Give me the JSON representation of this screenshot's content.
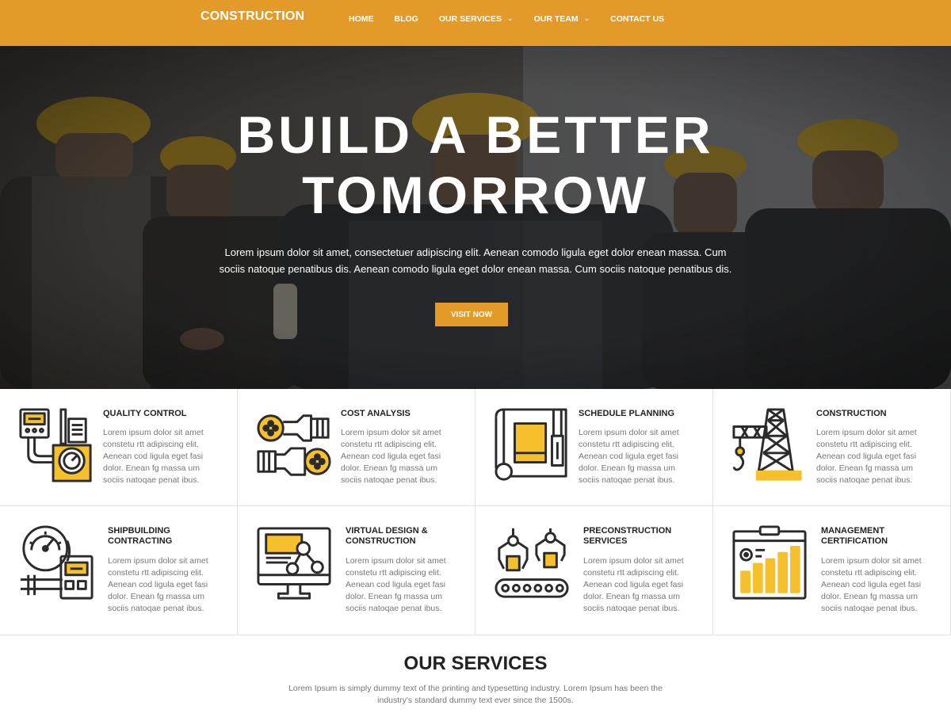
{
  "header": {
    "brand": "CONSTRUCTION",
    "nav": [
      {
        "label": "HOME",
        "dropdown": false
      },
      {
        "label": "BLOG",
        "dropdown": false
      },
      {
        "label": "OUR SERVICES",
        "dropdown": true
      },
      {
        "label": "OUR TEAM",
        "dropdown": true
      },
      {
        "label": "CONTACT US",
        "dropdown": false
      }
    ]
  },
  "hero": {
    "title_line1": "BUILD A BETTER",
    "title_line2": "TOMORROW",
    "text": "Lorem ipsum dolor sit amet, consectetuer adipiscing elit. Aenean comodo ligula eget dolor enean massa. Cum sociis natoque penatibus dis. Aenean comodo ligula eget dolor enean massa. Cum sociis natoque penatibus dis.",
    "button": "VISIT NOW"
  },
  "features": [
    {
      "title": "QUALITY CONTROL",
      "icon": "quality-control-icon",
      "text": "Lorem ipsum dolor sit amet constetu rtt adipiscing elit. Aenean cod ligula eget fasi dolor. Enean fg massa um sociis natoqae penat ibus."
    },
    {
      "title": "COST ANALYSIS",
      "icon": "cost-analysis-icon",
      "text": "Lorem ipsum dolor sit amet constetu rtt adipiscing elit. Aenean cod ligula eget fasi dolor. Enean fg massa um sociis natoqae penat ibus."
    },
    {
      "title": "SCHEDULE PLANNING",
      "icon": "blueprint-icon",
      "text": "Lorem ipsum dolor sit amet constetu rtt adipiscing elit. Aenean cod ligula eget fasi dolor. Enean fg massa um sociis natoqae penat ibus."
    },
    {
      "title": "CONSTRUCTION",
      "icon": "crane-icon",
      "text": "Lorem ipsum dolor sit amet constetu rtt adipiscing elit. Aenean cod ligula eget fasi dolor. Enean fg massa um sociis natoqae penat ibus."
    },
    {
      "title": "SHIPBUILDING CONTRACTING",
      "icon": "gauge-meter-icon",
      "text": "Lorem ipsum dolor sit amet constetu rtt adipiscing elit. Aenean cod ligula eget fasi dolor. Enean fg massa um sociis natoqae penat ibus."
    },
    {
      "title": "VIRTUAL DESIGN & CONSTRUCTION",
      "icon": "monitor-design-icon",
      "text": "Lorem ipsum dolor sit amet constetu rtt adipiscing elit. Aenean cod ligula eget fasi dolor. Enean fg massa um sociis natoqae penat ibus."
    },
    {
      "title": "PRECONSTRUCTION SERVICES",
      "icon": "conveyor-robot-icon",
      "text": "Lorem ipsum dolor sit amet constetu rtt adipiscing elit. Aenean cod ligula eget fasi dolor. Enean fg massa um sociis natoqae penat ibus."
    },
    {
      "title": "MANAGEMENT CERTIFICATION",
      "icon": "clipboard-chart-icon",
      "text": "Lorem ipsum dolor sit amet constetu rtt adipiscing elit. Aenean cod ligula eget fasi dolor. Enean fg massa um sociis natoqae penat ibus."
    }
  ],
  "services": {
    "title": "OUR SERVICES",
    "text": "Lorem Ipsum is simply dummy text of the printing and typesetting industry. Lorem Ipsum has been the industry's standard dummy text ever since the 1500s."
  },
  "colors": {
    "accent": "#e39a29",
    "icon_yellow": "#f6c02d",
    "icon_stroke": "#2b2b2b"
  }
}
